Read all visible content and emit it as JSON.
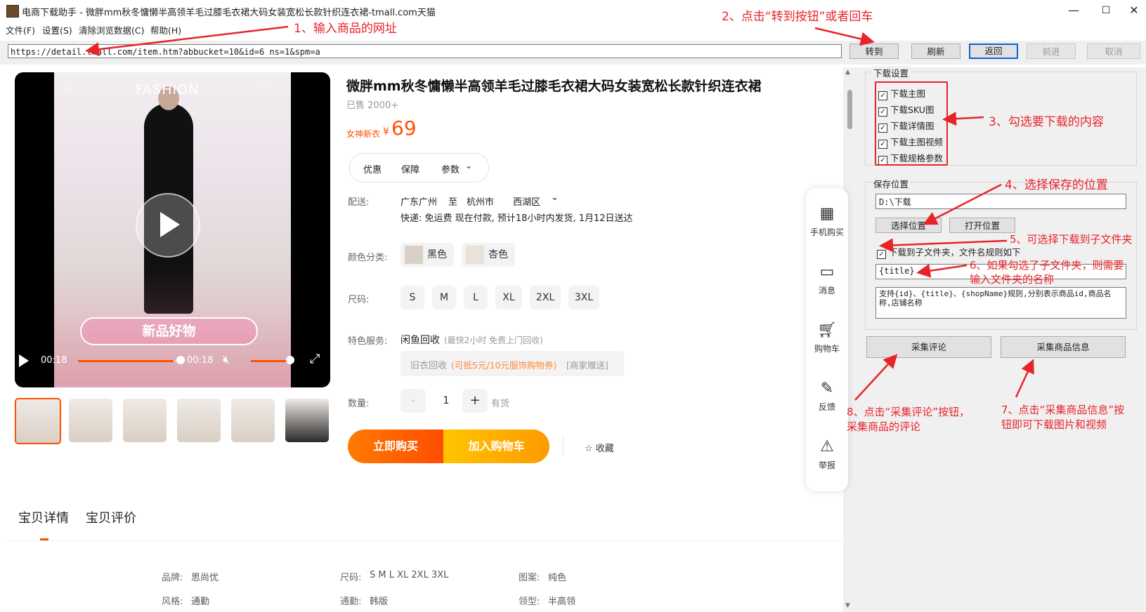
{
  "window": {
    "title": "电商下载助手 - 微胖mm秋冬慵懒半高领羊毛过膝毛衣裙大码女装宽松长款针织连衣裙-tmall.com天猫",
    "controls": [
      "—",
      "☐",
      "✕"
    ]
  },
  "menu": [
    "文件(F)",
    "设置(S)",
    "清除浏览数据(C)",
    "帮助(H)"
  ],
  "nav": {
    "url": "https://detail.tmall.com/item.htm?abbucket=10&id=6          ns=1&spm=a",
    "go": "转到",
    "refresh": "刷新",
    "back": "返回",
    "forward": "前进",
    "cancel": "取消"
  },
  "product": {
    "title": "微胖mm秋冬慵懒半高领羊毛过膝毛衣裙大码女装宽松长款针织连衣裙",
    "sold": "已售 2000+",
    "price_label": "女神新衣",
    "currency": "¥",
    "price": "69",
    "pills": [
      "优惠",
      "保障",
      "参数"
    ],
    "shipping_label": "配送:",
    "ship_from": "广东广州",
    "ship_to_word": "至",
    "ship_city": "杭州市",
    "ship_district": "西湖区",
    "ship_note": "快递: 免运费  现在付款, 预计18小时内发货, 1月12日送达",
    "color_label": "颜色分类:",
    "colors": [
      "黑色",
      "杏色"
    ],
    "size_label": "尺码:",
    "sizes": [
      "S",
      "M",
      "L",
      "XL",
      "2XL",
      "3XL"
    ],
    "service_label": "特色服务:",
    "service_name": "闲鱼回收",
    "service_note": "(最快2小时 免费上门回收)",
    "recycle_name": "旧衣回收",
    "recycle_highlight": "(可抵5元/10元服饰购物券)",
    "recycle_tag": "[商家赠送]",
    "qty_label": "数量:",
    "qty_minus": "-",
    "qty": "1",
    "qty_plus": "+",
    "stock": "有货",
    "buy_now": "立即购买",
    "add_cart": "加入购物车",
    "favorite": "☆ 收藏",
    "tabs": [
      "宝贝详情",
      "宝贝评价"
    ],
    "attrs": [
      {
        "k": "品牌:",
        "v": "思尚优"
      },
      {
        "k": "尺码:",
        "v": "S M L XL 2XL 3XL"
      },
      {
        "k": "图案:",
        "v": "纯色"
      },
      {
        "k": "风格:",
        "v": "通勤"
      },
      {
        "k": "通勤:",
        "v": "韩版"
      },
      {
        "k": "领型:",
        "v": "半高领"
      }
    ]
  },
  "video": {
    "overlay_top": "FASHION",
    "banner": "新品好物",
    "time_current": "00:18",
    "time_total": "00:18",
    "progress": 0.93
  },
  "side_actions": [
    "手机购买",
    "消息",
    "购物车",
    "反馈",
    "举报"
  ],
  "panel": {
    "download_group": "下载设置",
    "options": [
      "下载主图",
      "下载SKU图",
      "下载详情图",
      "下载主图视频",
      "下载规格参数"
    ],
    "save_group": "保存位置",
    "save_path": "D:\\下载",
    "choose_location": "选择位置",
    "open_location": "打开位置",
    "subfolder_option": "下载到子文件夹，文件名规则如下",
    "folder_rule": "{title}",
    "rule_help": "支持{id}、{title}、{shopName}规则,分别表示商品id,商品名称,店铺名称",
    "collect_reviews": "采集评论",
    "collect_info": "采集商品信息"
  },
  "annotations": {
    "a1": "1、输入商品的网址",
    "a2": "2、点击“转到按钮”或者回车",
    "a3": "3、勾选要下载的内容",
    "a4": "4、选择保存的位置",
    "a5": "5、可选择下载到子文件夹",
    "a6_l1": "6、如果勾选了子文件夹，则需要",
    "a6_l2": "输入文件夹的名称",
    "a7_l1": "7、点击“采集商品信息”按",
    "a7_l2": "钮即可下载图片和视频",
    "a8_l1": "8、点击“采集评论”按钮，",
    "a8_l2": "采集商品的评论"
  },
  "colors": {
    "accent_red": "#e8232a",
    "tmall_orange": "#ff5000",
    "buy_gradient_start": "#ff7a00",
    "cart_gradient": "#ffc400"
  }
}
